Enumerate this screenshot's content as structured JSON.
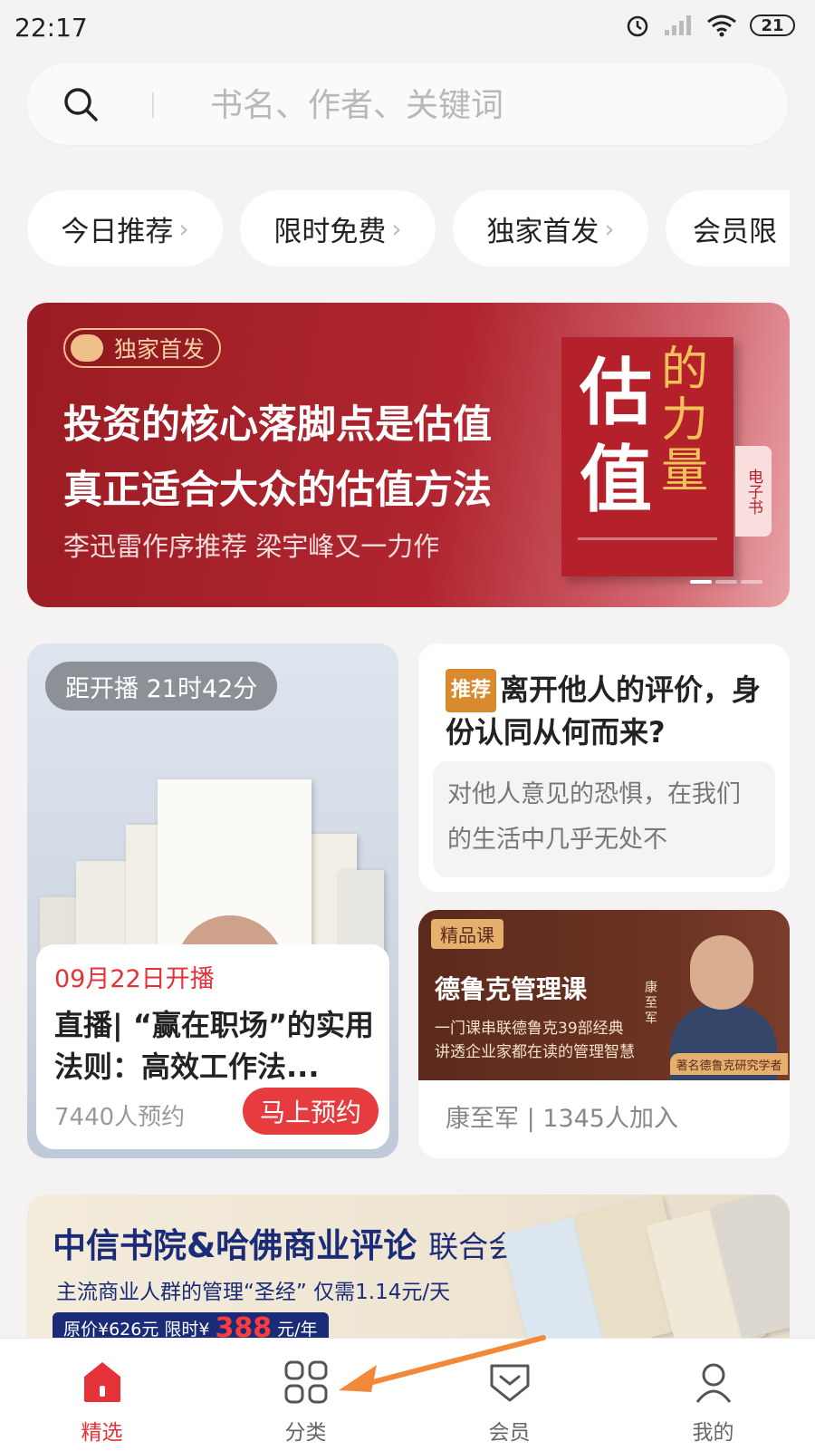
{
  "status": {
    "time": "22:17",
    "battery": "21"
  },
  "search": {
    "placeholder": "书名、作者、关键词"
  },
  "chips": [
    "今日推荐",
    "限时免费",
    "独家首发",
    "会员限"
  ],
  "banner": {
    "tag": "独家首发",
    "headline1": "投资的核心落脚点是估值",
    "headline2": "真正适合大众的估值方法",
    "subtitle": "李迅雷作序推荐 梁宇峰又一力作",
    "book_title_big": "估值",
    "book_title_small": "的力量",
    "ebook_label": "电子书"
  },
  "live": {
    "countdown": "距开播 21时42分",
    "date": "09月22日开播",
    "title": "直播| “赢在职场”的实用法则：高效工作法...",
    "count": "7440人预约",
    "button": "马上预约"
  },
  "recommend": {
    "badge": "推荐",
    "title": "离开他人的评价，身份认同从何而来?",
    "quote": "对他人意见的恐惧，在我们的生活中几乎无处不"
  },
  "course": {
    "tag": "精品课",
    "title": "德鲁克管理课",
    "line1": "一门课串联德鲁克39部经典",
    "line2": "讲透企业家都在读的管理智慧",
    "name_vertical": "康至军",
    "scholar": "著名德鲁克研究学者",
    "meta": "康至军 | 1345人加入"
  },
  "promo": {
    "title": "中信书院&哈佛商业评论",
    "title_suffix": "联合会员",
    "subtitle": "主流商业人群的管理“圣经” 仅需1.14元/天",
    "price_prefix": "原价¥626元 限时¥",
    "price_value": "388",
    "price_suffix": "元/年"
  },
  "nav": {
    "items": [
      {
        "label": "精选",
        "icon": "home-icon",
        "active": true
      },
      {
        "label": "分类",
        "icon": "grid-icon",
        "active": false
      },
      {
        "label": "会员",
        "icon": "diamond-icon",
        "active": false
      },
      {
        "label": "我的",
        "icon": "profile-icon",
        "active": false
      }
    ]
  },
  "colors": {
    "accent": "#e53238",
    "banner_red": "#a9232c",
    "promo_blue": "#1a2b78",
    "course_brown": "#5b2a1c"
  }
}
